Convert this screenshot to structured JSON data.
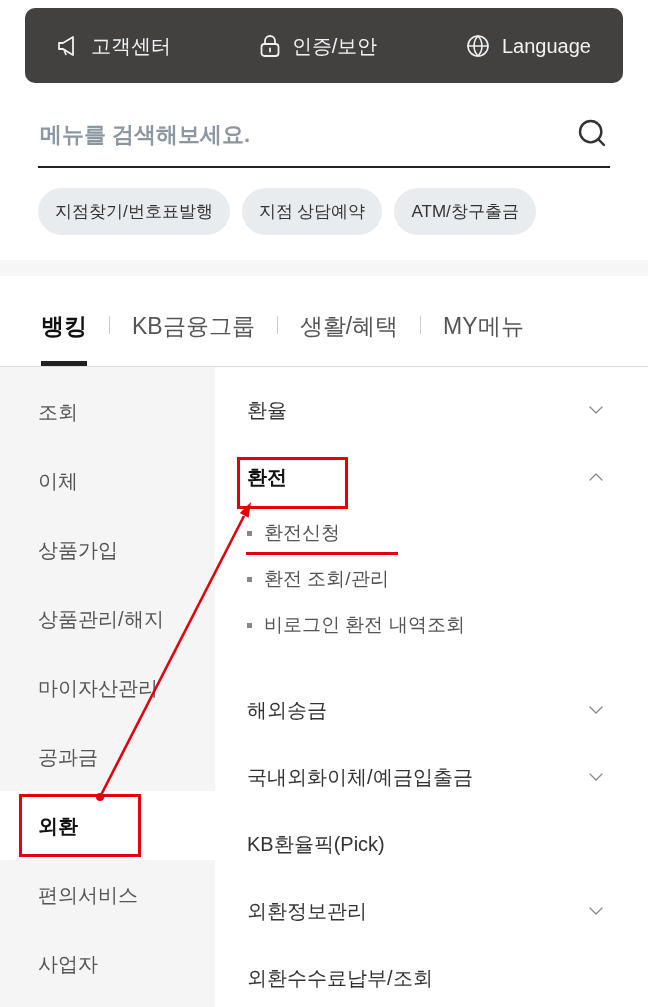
{
  "top_bar": {
    "items": [
      {
        "label": "고객센터"
      },
      {
        "label": "인증/보안"
      },
      {
        "label": "Language"
      }
    ]
  },
  "search": {
    "placeholder": "메뉴를 검색해보세요."
  },
  "quick_links": [
    {
      "label": "지점찾기/번호표발행"
    },
    {
      "label": "지점 상담예약"
    },
    {
      "label": "ATM/창구출금"
    }
  ],
  "tabs": [
    {
      "label": "뱅킹",
      "selected": true
    },
    {
      "label": "KB금융그룹",
      "selected": false
    },
    {
      "label": "생활/혜택",
      "selected": false
    },
    {
      "label": "MY메뉴",
      "selected": false
    }
  ],
  "sidebar": {
    "items": [
      {
        "label": "조회",
        "selected": false,
        "annotated": false
      },
      {
        "label": "이체",
        "selected": false,
        "annotated": false
      },
      {
        "label": "상품가입",
        "selected": false,
        "annotated": false
      },
      {
        "label": "상품관리/해지",
        "selected": false,
        "annotated": false
      },
      {
        "label": "마이자산관리",
        "selected": false,
        "annotated": false
      },
      {
        "label": "공과금",
        "selected": false,
        "annotated": false
      },
      {
        "label": "외환",
        "selected": true,
        "annotated": true
      },
      {
        "label": "편의서비스",
        "selected": false,
        "annotated": false
      },
      {
        "label": "사업자",
        "selected": false,
        "annotated": false
      }
    ]
  },
  "menu": {
    "items": [
      {
        "kind": "group",
        "label": "환율",
        "expanded": false,
        "annotated": false
      },
      {
        "kind": "group",
        "label": "환전",
        "expanded": true,
        "annotated": true,
        "children": [
          {
            "label": "환전신청",
            "annotated": true
          },
          {
            "label": "환전 조회/관리",
            "annotated": false
          },
          {
            "label": "비로그인 환전 내역조회",
            "annotated": false
          }
        ]
      },
      {
        "kind": "group",
        "label": "해외송금",
        "expanded": false,
        "annotated": false
      },
      {
        "kind": "group",
        "label": "국내외화이체/예금입출금",
        "expanded": false,
        "annotated": false
      },
      {
        "kind": "link",
        "label": "KB환율픽(Pick)",
        "annotated": false
      },
      {
        "kind": "group",
        "label": "외환정보관리",
        "expanded": false,
        "annotated": false
      },
      {
        "kind": "link",
        "label": "외환수수료납부/조회",
        "annotated": false
      }
    ]
  }
}
